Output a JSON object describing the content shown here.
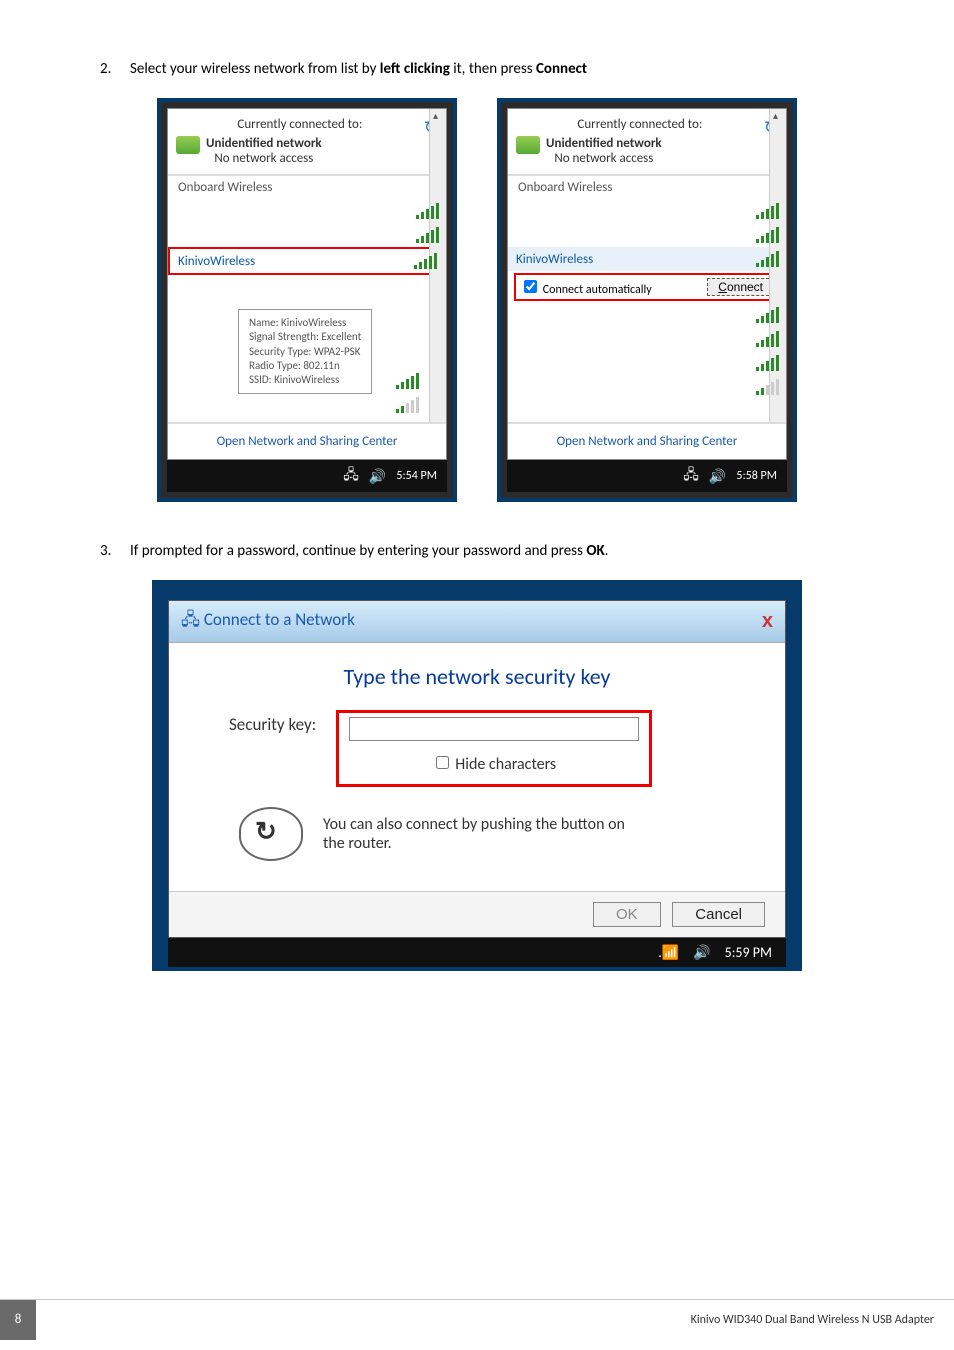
{
  "steps": {
    "s2_num": "2.",
    "s2_text_a": "Select your wireless network from list by ",
    "s2_text_b": "left clicking",
    "s2_text_c": " it, then press ",
    "s2_text_d": "Connect",
    "s3_num": "3.",
    "s3_text_a": "If prompted for a password, continue by entering your password and press ",
    "s3_text_b": "OK",
    "s3_text_c": "."
  },
  "popup": {
    "hdr": "Currently connected to:",
    "net_name": "Unidentified network",
    "net_status": "No network access",
    "adapter": "Onboard Wireless",
    "target": "KinivoWireless",
    "footlink": "Open Network and Sharing Center",
    "caret_up": "˄",
    "blank": " "
  },
  "tooltip": {
    "l1": "Name: KinivoWireless",
    "l2": "Signal Strength: Excellent",
    "l3": "Security Type: WPA2-PSK",
    "l4": "Radio Type: 802.11n",
    "l5": "SSID: KinivoWireless"
  },
  "connect": {
    "checkbox": "Connect automatically",
    "button": "Connect",
    "underline": "C"
  },
  "times": {
    "t1": "5:54 PM",
    "t2": "5:58 PM",
    "t3": "5:59 PM"
  },
  "dialog": {
    "title": "Connect to a Network",
    "heading": "Type the network security key",
    "keylabel": "Security key:",
    "hide": "Hide characters",
    "router_msg": "You can also connect by pushing the button on the router.",
    "ok": "OK",
    "cancel": "Cancel",
    "close": "x"
  },
  "footer": {
    "page": "8",
    "product": "Kinivo WID340 Dual Band Wireless N USB Adapter"
  }
}
